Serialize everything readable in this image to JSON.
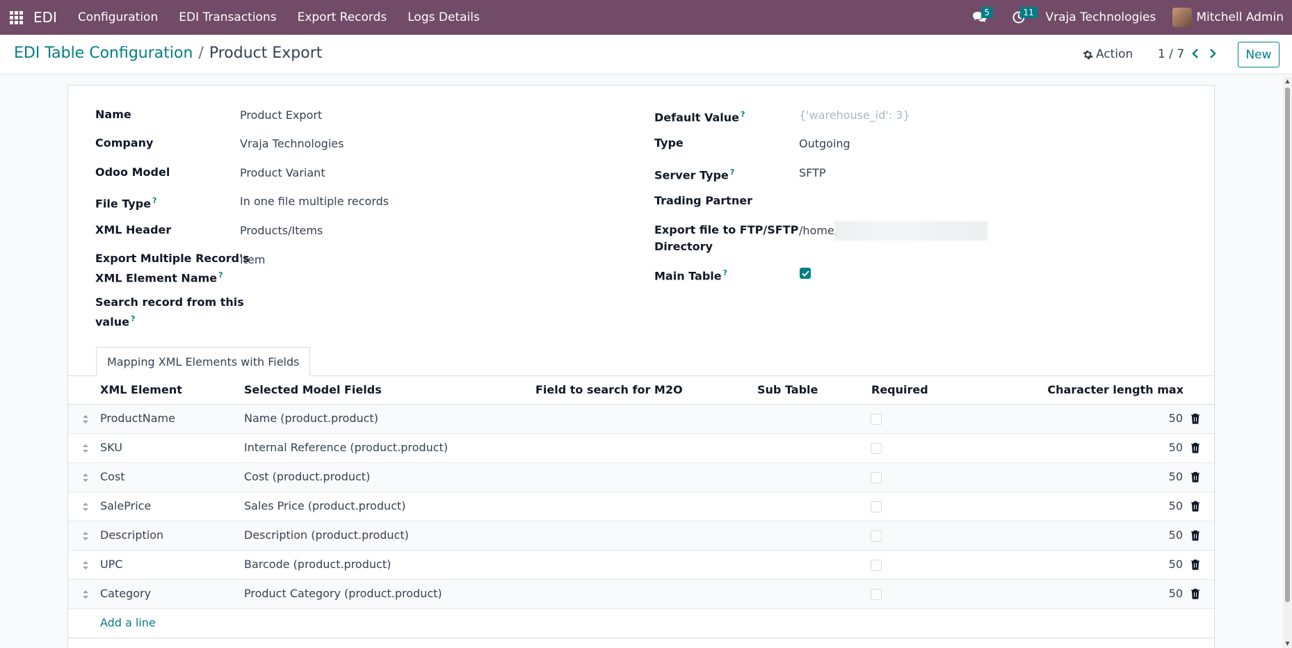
{
  "navbar": {
    "brand": "EDI",
    "menu": [
      "Configuration",
      "EDI Transactions",
      "Export Records",
      "Logs Details"
    ],
    "messages_count": "5",
    "activities_count": "11",
    "company": "Vraja Technologies",
    "user": "Mitchell Admin"
  },
  "control_panel": {
    "breadcrumb_parent": "EDI Table Configuration",
    "breadcrumb_sep": "/",
    "breadcrumb_current": "Product Export",
    "action_label": "Action",
    "pager": "1 / 7",
    "new_label": "New"
  },
  "form": {
    "left": [
      {
        "label": "Name",
        "value": "Product Export"
      },
      {
        "label": "Company",
        "value": "Vraja Technologies"
      },
      {
        "label": "Odoo Model",
        "value": "Product Variant"
      },
      {
        "label": "File Type",
        "value": "In one file multiple records"
      },
      {
        "label": "XML Header",
        "value": "Products/Items"
      },
      {
        "label_line1": "Export Multiple Record's",
        "label_line2": "XML Element Name",
        "value": "Item"
      },
      {
        "label_line1": "Search record from this",
        "label_line2": "value",
        "value": ""
      }
    ],
    "right": [
      {
        "label": "Default Value",
        "value": "{'warehouse_id': 3}"
      },
      {
        "label": "Type",
        "value": "Outgoing"
      },
      {
        "label": "Server Type",
        "value": "SFTP"
      },
      {
        "label": "Trading Partner",
        "value": ""
      },
      {
        "label_line1": "Export file to FTP/SFTP",
        "label_line2": "Directory",
        "value": "/home/"
      },
      {
        "label": "Main Table",
        "checked": true
      }
    ],
    "help_mark": "?"
  },
  "tab": {
    "label": "Mapping XML Elements with Fields"
  },
  "table": {
    "headers": {
      "xml_element": "XML Element",
      "model_fields": "Selected Model Fields",
      "m2o": "Field to search for M2O",
      "sub_table": "Sub Table",
      "required": "Required",
      "max_len": "Character length max"
    },
    "rows": [
      {
        "xml": "ProductName",
        "field": "Name (product.product)",
        "max": "50"
      },
      {
        "xml": "SKU",
        "field": "Internal Reference (product.product)",
        "max": "50"
      },
      {
        "xml": "Cost",
        "field": "Cost (product.product)",
        "max": "50"
      },
      {
        "xml": "SalePrice",
        "field": "Sales Price (product.product)",
        "max": "50"
      },
      {
        "xml": "Description",
        "field": "Description (product.product)",
        "max": "50"
      },
      {
        "xml": "UPC",
        "field": "Barcode (product.product)",
        "max": "50"
      },
      {
        "xml": "Category",
        "field": "Product Category (product.product)",
        "max": "50"
      }
    ],
    "add_line": "Add a line"
  },
  "colors": {
    "navbar": "#714b67",
    "accent": "#017e84",
    "badge": "#017e84"
  }
}
